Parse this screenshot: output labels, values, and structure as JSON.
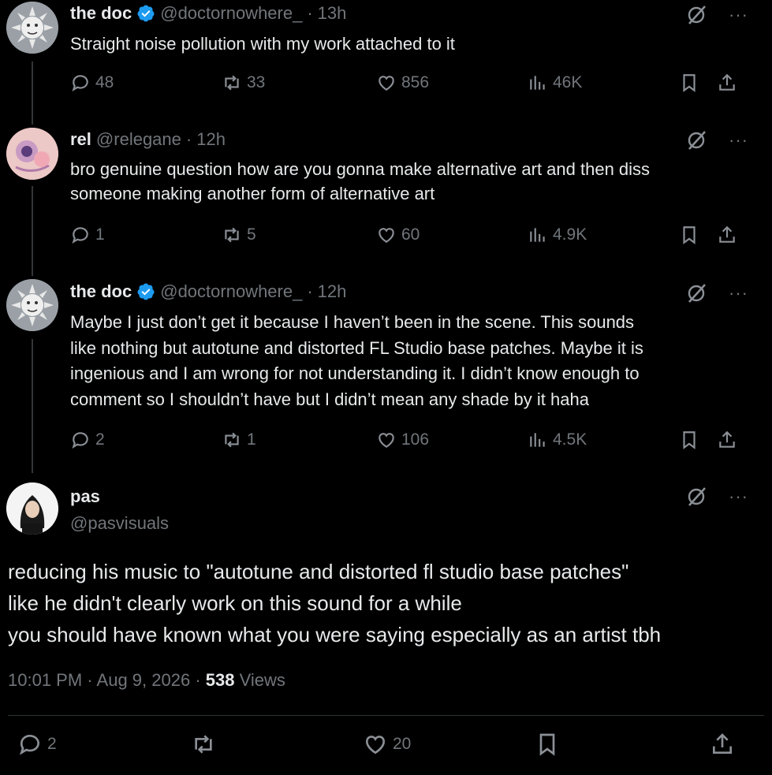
{
  "tweets": [
    {
      "name": "the doc",
      "handle": "@doctornowhere_",
      "dot": "·",
      "time": "13h",
      "text": "Straight noise pollution with my work attached to it",
      "replies": "48",
      "reposts": "33",
      "likes": "856",
      "views": "46K"
    },
    {
      "name": "rel",
      "handle": "@relegane",
      "dot": "·",
      "time": "12h",
      "text_lines": [
        "bro genuine question how are you gonna make alternative art and then diss",
        "someone making another form of alternative art"
      ],
      "replies": "1",
      "reposts": "5",
      "likes": "60",
      "views": "4.9K"
    },
    {
      "name": "the doc",
      "handle": "@doctornowhere_",
      "dot": "·",
      "time": "12h",
      "text_lines": [
        "Maybe I just don’t get it because I haven’t been in the scene. This sounds",
        "like nothing but autotune and distorted FL Studio base patches. Maybe it is",
        "ingenious and I am wrong for not understanding it. I didn’t know enough to",
        "comment so I shouldn’t have but I didn’t mean any shade by it haha"
      ],
      "replies": "2",
      "reposts": "1",
      "likes": "106",
      "views": "4.5K"
    }
  ],
  "main": {
    "name": "pas",
    "handle": "@pasvisuals",
    "text_lines": [
      "reducing his music to \"autotune and distorted fl studio base patches\"",
      "like he didn't clearly work on this sound for a while",
      "you should have known what you were saying especially as an artist tbh"
    ],
    "time": "10:01 PM",
    "date": "Aug 9, 2026",
    "views_count": "538",
    "views_label": "Views",
    "sep": "·",
    "replies": "2",
    "likes": "20"
  },
  "more_label": "···",
  "icons": [
    "grok-icon",
    "more-icon",
    "reply-icon",
    "repost-icon",
    "like-icon",
    "views-icon",
    "bookmark-icon",
    "share-icon",
    "verified-icon"
  ],
  "colors": {
    "background": "#000000",
    "text": "#e7e9ea",
    "muted": "#71767b",
    "verified": "#1d9bf0"
  }
}
